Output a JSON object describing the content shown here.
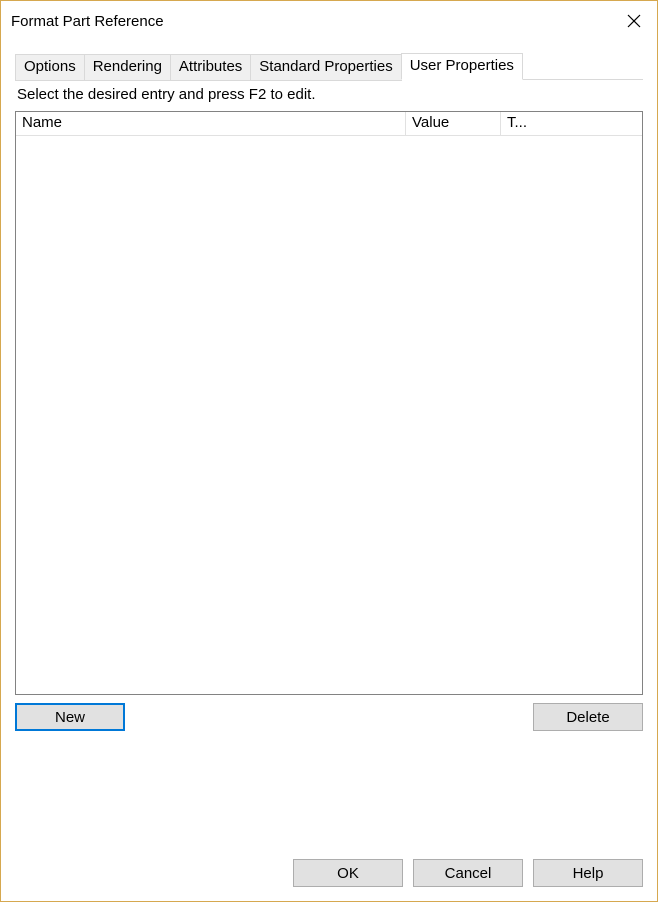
{
  "title": "Format Part Reference",
  "tabs": [
    {
      "label": "Options"
    },
    {
      "label": "Rendering"
    },
    {
      "label": "Attributes"
    },
    {
      "label": "Standard Properties"
    },
    {
      "label": "User Properties"
    }
  ],
  "active_tab_index": 4,
  "instructions": "Select the desired entry and press F2 to edit.",
  "columns": {
    "name": "Name",
    "value": "Value",
    "type": "T..."
  },
  "rows": [],
  "buttons": {
    "new": "New",
    "delete": "Delete",
    "ok": "OK",
    "cancel": "Cancel",
    "help": "Help"
  }
}
